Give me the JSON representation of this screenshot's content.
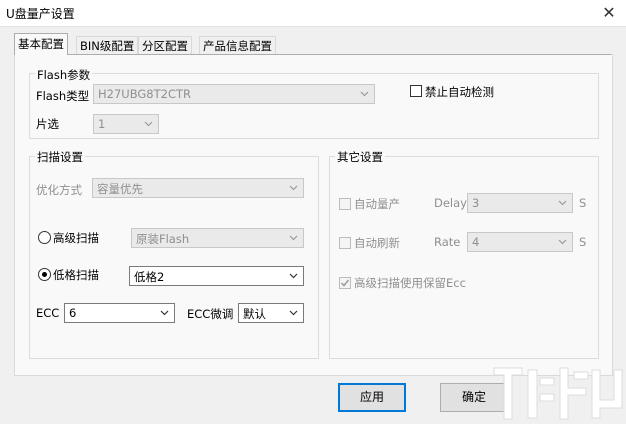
{
  "window": {
    "title": "U盘量产设置"
  },
  "tabs": [
    {
      "label": "基本配置",
      "active": true
    },
    {
      "label": "BIN级配置",
      "active": false
    },
    {
      "label": "分区配置",
      "active": false
    },
    {
      "label": "产品信息配置",
      "active": false
    }
  ],
  "flash_params": {
    "group_label": "Flash参数",
    "type_label": "Flash类型",
    "type_value": "H27UBG8T2CTR",
    "chip_select_label": "片选",
    "chip_select_value": "1",
    "disable_auto_detect_label": "禁止自动检测",
    "disable_auto_detect_checked": false
  },
  "scan_settings": {
    "group_label": "扫描设置",
    "optimize_label": "优化方式",
    "optimize_value": "容量优先",
    "advanced_scan_label": "高级扫描",
    "advanced_scan_value": "原装Flash",
    "advanced_scan_selected": false,
    "lowlevel_scan_label": "低格扫描",
    "lowlevel_scan_value": "低格2",
    "lowlevel_scan_selected": true,
    "ecc_label": "ECC",
    "ecc_value": "6",
    "ecc_tune_label": "ECC微调",
    "ecc_tune_value": "默认"
  },
  "other_settings": {
    "group_label": "其它设置",
    "auto_production_label": "自动量产",
    "auto_production_checked": false,
    "delay_label": "Delay",
    "delay_value": "3",
    "delay_unit": "S",
    "auto_refresh_label": "自动刷新",
    "auto_refresh_checked": false,
    "rate_label": "Rate",
    "rate_value": "4",
    "rate_unit": "S",
    "adv_scan_keep_ecc_label": "高级扫描使用保留Ecc",
    "adv_scan_keep_ecc_checked": true
  },
  "buttons": {
    "apply": "应用",
    "ok": "确定"
  },
  "colors": {
    "accent_border": "#0078d7",
    "panel_bg": "#f9f9f9",
    "window_bg": "#f0f0f0"
  }
}
